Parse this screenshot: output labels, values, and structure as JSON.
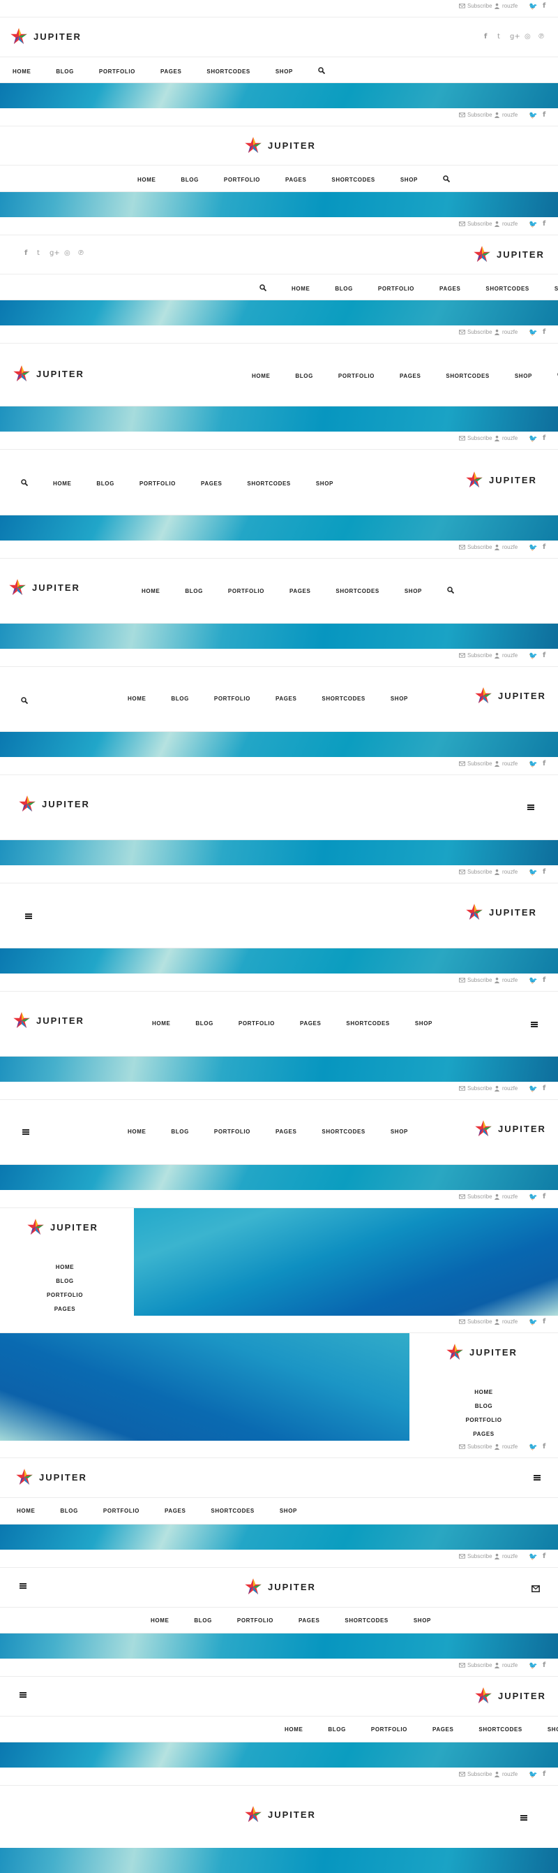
{
  "brand": {
    "name": "JUPITER"
  },
  "topbar": {
    "subscribe": "Subscribe",
    "user": "rouzfe"
  },
  "nav": {
    "items": [
      "HOME",
      "BLOG",
      "PORTFOLIO",
      "PAGES",
      "SHORTCODES",
      "SHOP"
    ]
  },
  "social": [
    "facebook-icon",
    "twitter-icon",
    "google-plus-icon",
    "dribbble-icon",
    "pinterest-icon"
  ],
  "colors": {
    "banner_dark": "#0a78b0",
    "banner_light": "#b6e2e0",
    "text": "#222222",
    "muted": "#9a9a9a"
  }
}
